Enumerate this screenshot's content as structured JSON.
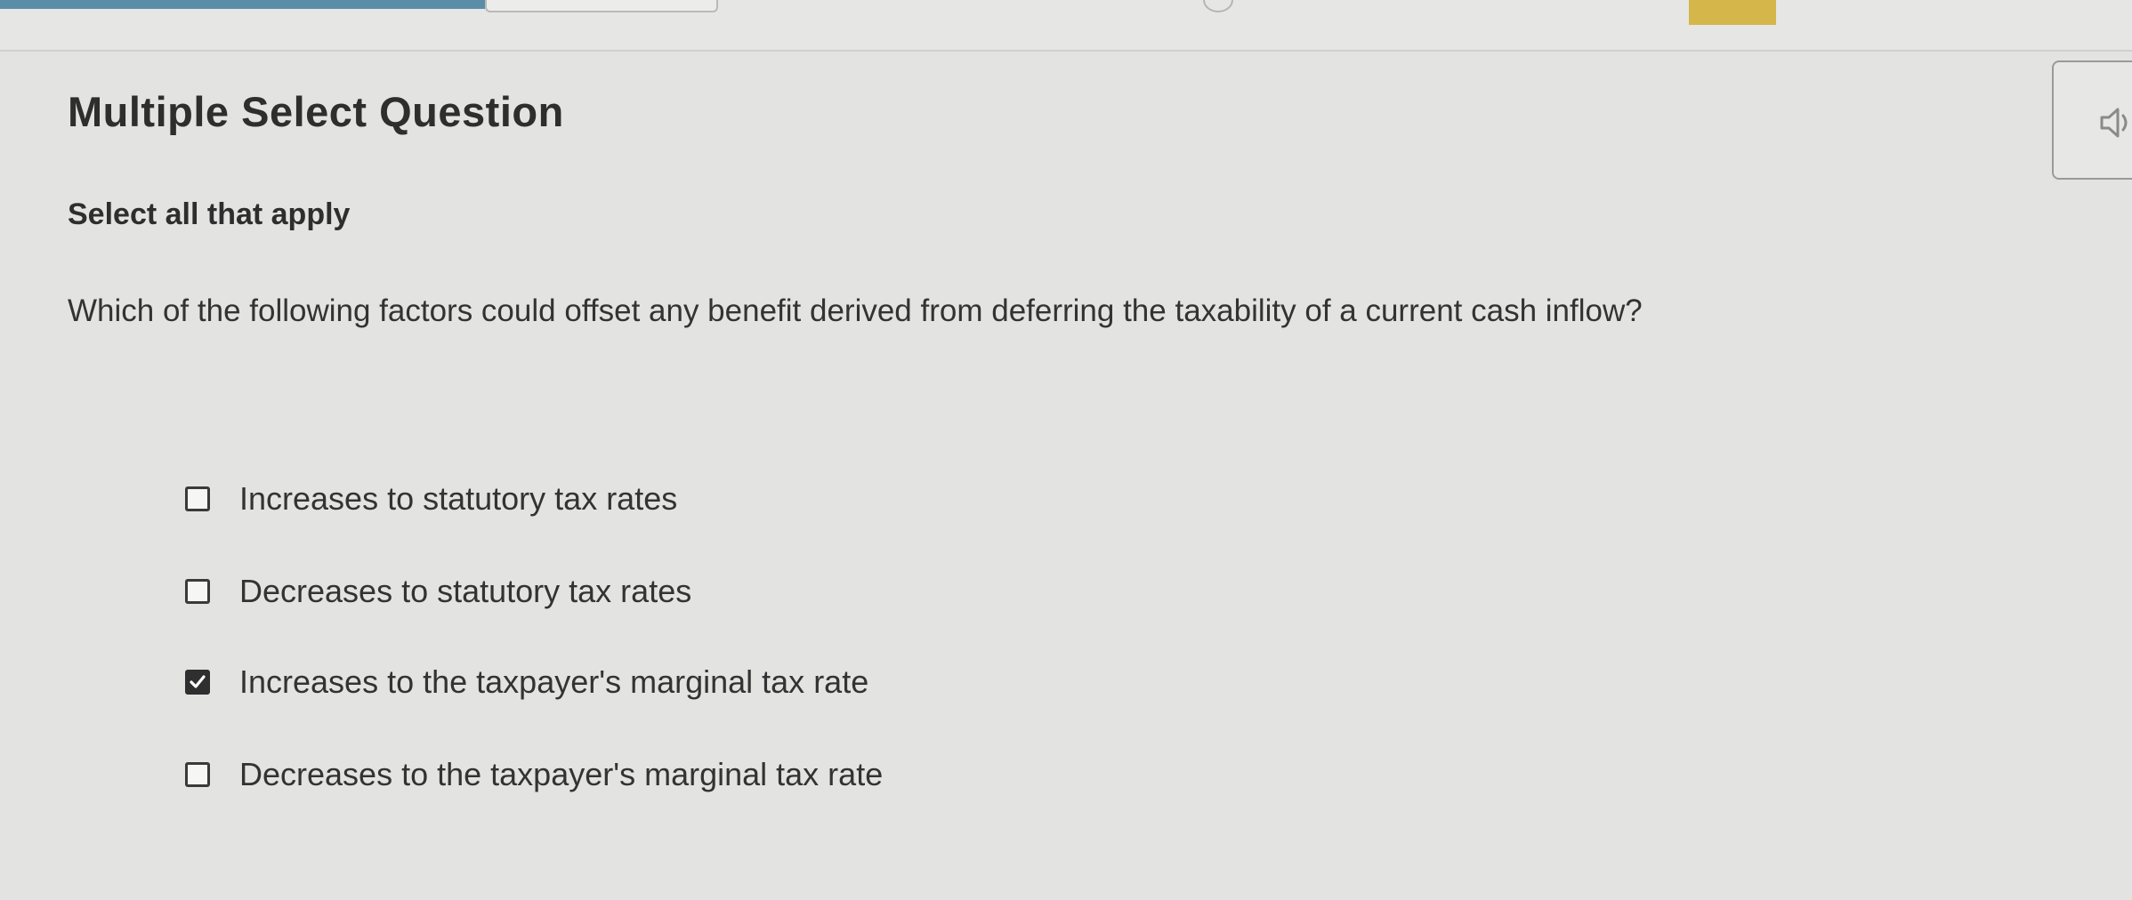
{
  "header": {
    "question_type": "Multiple Select Question",
    "audio_icon": "speaker-icon"
  },
  "question": {
    "instruction": "Select all that apply",
    "prompt": "Which of the following factors could offset any benefit derived from deferring the taxability of a current cash inflow?"
  },
  "options": [
    {
      "label": "Increases to statutory tax rates",
      "checked": false
    },
    {
      "label": "Decreases to statutory tax rates",
      "checked": false
    },
    {
      "label": "Increases to the taxpayer's marginal tax rate",
      "checked": true
    },
    {
      "label": "Decreases to the taxpayer's marginal tax rate",
      "checked": false
    }
  ],
  "colors": {
    "background": "#e3e3e2",
    "text": "#2e2e2e",
    "checkbox_checked": "#2f2f2f",
    "top_tab_accent": "#5a8ea8",
    "top_marker": "#d5b64a"
  }
}
